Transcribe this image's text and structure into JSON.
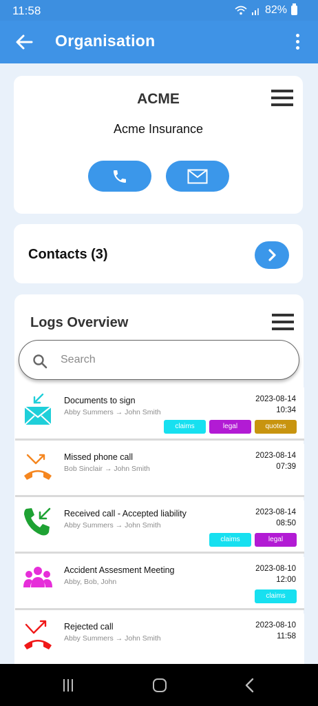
{
  "status": {
    "time": "11:58",
    "battery": "82%"
  },
  "appbar": {
    "title": "Organisation"
  },
  "org": {
    "code": "ACME",
    "name": "Acme Insurance"
  },
  "contacts": {
    "label": "Contacts (3)"
  },
  "logs": {
    "title": "Logs Overview",
    "search_placeholder": "Search",
    "items": [
      {
        "icon": "email-incoming-icon",
        "title": "Documents to sign",
        "people": "Abby Summers → John Smith",
        "date": "2023-08-14",
        "time": "10:34",
        "tags": [
          {
            "label": "claims",
            "color": "#17e0f0"
          },
          {
            "label": "legal",
            "color": "#b21bd4"
          },
          {
            "label": "quotes",
            "color": "#c8940f"
          }
        ]
      },
      {
        "icon": "missed-call-icon",
        "title": "Missed phone call",
        "people": "Bob Sinclair → John Smith",
        "date": "2023-08-14",
        "time": "07:39",
        "tags": []
      },
      {
        "icon": "received-call-icon",
        "title": "Received call - Accepted liability",
        "people": "Abby Summers → John Smith",
        "date": "2023-08-14",
        "time": "08:50",
        "tags": [
          {
            "label": "claims",
            "color": "#17e0f0"
          },
          {
            "label": "legal",
            "color": "#b21bd4"
          }
        ]
      },
      {
        "icon": "meeting-group-icon",
        "title": "Accident Assesment Meeting",
        "people": "Abby, Bob, John",
        "date": "2023-08-10",
        "time": "12:00",
        "tags": [
          {
            "label": "claims",
            "color": "#17e0f0"
          }
        ]
      },
      {
        "icon": "rejected-call-icon",
        "title": "Rejected call",
        "people": "Abby Summers → John Smith",
        "date": "2023-08-10",
        "time": "11:58",
        "tags": []
      }
    ]
  },
  "colors": {
    "primary": "#3b97ea",
    "appbar": "#3f93e6",
    "background": "#e9f1fa"
  }
}
